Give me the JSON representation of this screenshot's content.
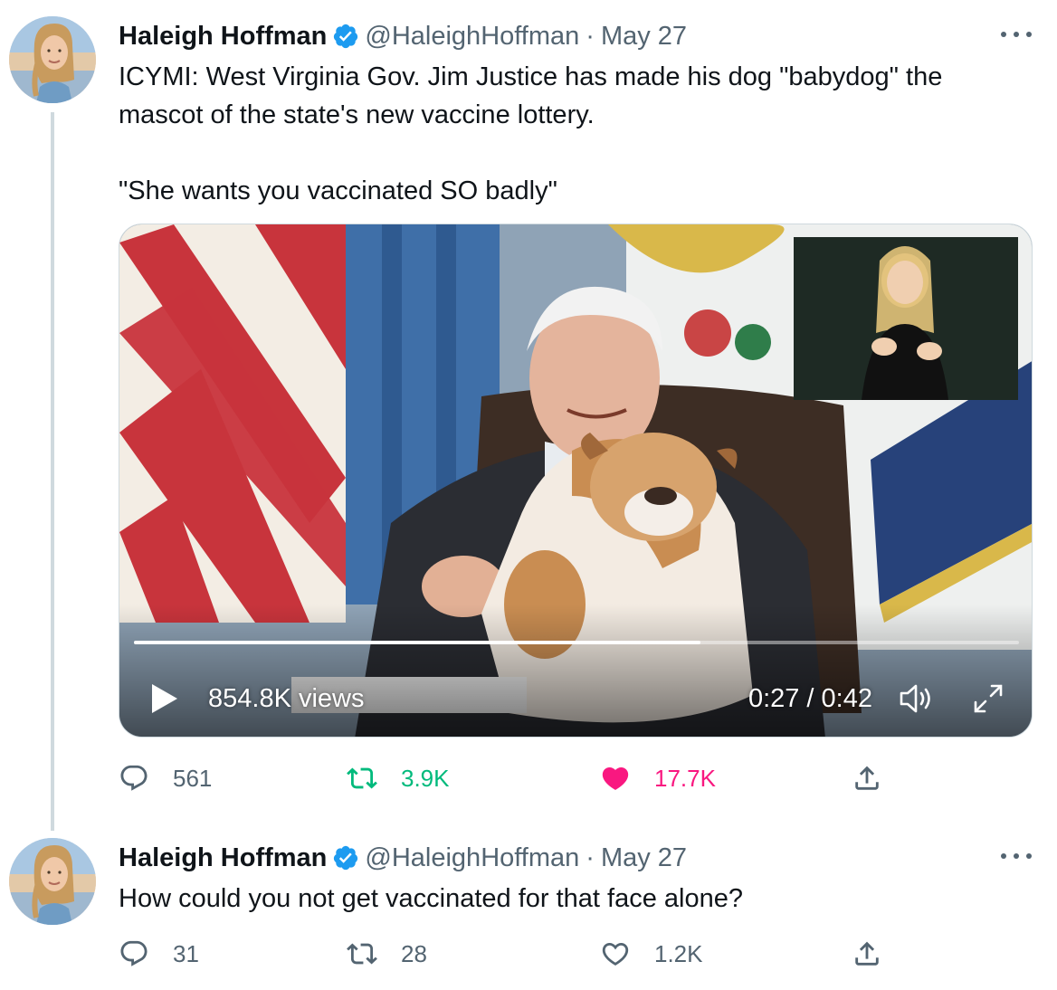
{
  "tweets": [
    {
      "author_name": "Haleigh Hoffman",
      "author_handle": "@HaleighHoffman",
      "separator": "·",
      "date": "May 27",
      "text_line1": "ICYMI: West Virginia Gov. Jim Justice has made his dog \"babydog\" the mascot of the state's new vaccine lottery.",
      "text_line2": "\"She wants you vaccinated SO badly\"",
      "video": {
        "views": "854.8K views",
        "timecode": "0:27 / 0:42",
        "progress": 0.64
      },
      "replies": "561",
      "retweets": "3.9K",
      "likes": "17.7K",
      "retweeted": true,
      "liked": true
    },
    {
      "author_name": "Haleigh Hoffman",
      "author_handle": "@HaleighHoffman",
      "separator": "·",
      "date": "May 27",
      "text_line1": "How could you not get vaccinated for that face alone?",
      "replies": "31",
      "retweets": "28",
      "likes": "1.2K",
      "retweeted": false,
      "liked": false
    }
  ],
  "colors": {
    "verified": "#1d9bf0",
    "retweet_active": "#00ba7c",
    "like_active": "#f91880",
    "secondary_text": "#536471"
  },
  "icons": [
    "avatar",
    "verified-badge-icon",
    "more-icon",
    "play-icon",
    "volume-icon",
    "fullscreen-icon",
    "reply-icon",
    "retweet-icon",
    "like-icon",
    "share-icon"
  ]
}
